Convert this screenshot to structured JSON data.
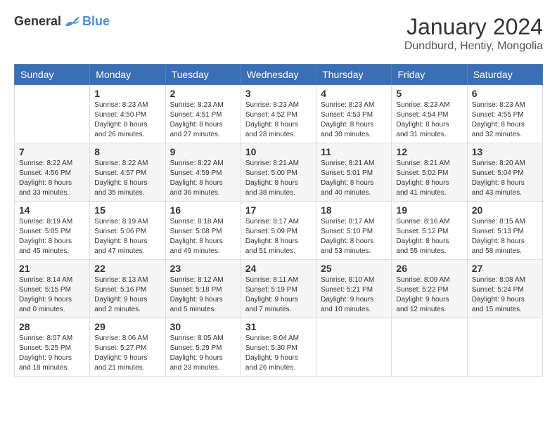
{
  "header": {
    "logo": {
      "general": "General",
      "blue": "Blue"
    },
    "title": "January 2024",
    "location": "Dundburd, Hentiy, Mongolia"
  },
  "weekdays": [
    "Sunday",
    "Monday",
    "Tuesday",
    "Wednesday",
    "Thursday",
    "Friday",
    "Saturday"
  ],
  "weeks": [
    [
      {
        "day": "",
        "sunrise": "",
        "sunset": "",
        "daylight": ""
      },
      {
        "day": "1",
        "sunrise": "Sunrise: 8:23 AM",
        "sunset": "Sunset: 4:50 PM",
        "daylight": "Daylight: 8 hours and 26 minutes."
      },
      {
        "day": "2",
        "sunrise": "Sunrise: 8:23 AM",
        "sunset": "Sunset: 4:51 PM",
        "daylight": "Daylight: 8 hours and 27 minutes."
      },
      {
        "day": "3",
        "sunrise": "Sunrise: 8:23 AM",
        "sunset": "Sunset: 4:52 PM",
        "daylight": "Daylight: 8 hours and 28 minutes."
      },
      {
        "day": "4",
        "sunrise": "Sunrise: 8:23 AM",
        "sunset": "Sunset: 4:53 PM",
        "daylight": "Daylight: 8 hours and 30 minutes."
      },
      {
        "day": "5",
        "sunrise": "Sunrise: 8:23 AM",
        "sunset": "Sunset: 4:54 PM",
        "daylight": "Daylight: 8 hours and 31 minutes."
      },
      {
        "day": "6",
        "sunrise": "Sunrise: 8:23 AM",
        "sunset": "Sunset: 4:55 PM",
        "daylight": "Daylight: 8 hours and 32 minutes."
      }
    ],
    [
      {
        "day": "7",
        "sunrise": "Sunrise: 8:22 AM",
        "sunset": "Sunset: 4:56 PM",
        "daylight": "Daylight: 8 hours and 33 minutes."
      },
      {
        "day": "8",
        "sunrise": "Sunrise: 8:22 AM",
        "sunset": "Sunset: 4:57 PM",
        "daylight": "Daylight: 8 hours and 35 minutes."
      },
      {
        "day": "9",
        "sunrise": "Sunrise: 8:22 AM",
        "sunset": "Sunset: 4:59 PM",
        "daylight": "Daylight: 8 hours and 36 minutes."
      },
      {
        "day": "10",
        "sunrise": "Sunrise: 8:21 AM",
        "sunset": "Sunset: 5:00 PM",
        "daylight": "Daylight: 8 hours and 38 minutes."
      },
      {
        "day": "11",
        "sunrise": "Sunrise: 8:21 AM",
        "sunset": "Sunset: 5:01 PM",
        "daylight": "Daylight: 8 hours and 40 minutes."
      },
      {
        "day": "12",
        "sunrise": "Sunrise: 8:21 AM",
        "sunset": "Sunset: 5:02 PM",
        "daylight": "Daylight: 8 hours and 41 minutes."
      },
      {
        "day": "13",
        "sunrise": "Sunrise: 8:20 AM",
        "sunset": "Sunset: 5:04 PM",
        "daylight": "Daylight: 8 hours and 43 minutes."
      }
    ],
    [
      {
        "day": "14",
        "sunrise": "Sunrise: 8:19 AM",
        "sunset": "Sunset: 5:05 PM",
        "daylight": "Daylight: 8 hours and 45 minutes."
      },
      {
        "day": "15",
        "sunrise": "Sunrise: 8:19 AM",
        "sunset": "Sunset: 5:06 PM",
        "daylight": "Daylight: 8 hours and 47 minutes."
      },
      {
        "day": "16",
        "sunrise": "Sunrise: 8:18 AM",
        "sunset": "Sunset: 5:08 PM",
        "daylight": "Daylight: 8 hours and 49 minutes."
      },
      {
        "day": "17",
        "sunrise": "Sunrise: 8:17 AM",
        "sunset": "Sunset: 5:09 PM",
        "daylight": "Daylight: 8 hours and 51 minutes."
      },
      {
        "day": "18",
        "sunrise": "Sunrise: 8:17 AM",
        "sunset": "Sunset: 5:10 PM",
        "daylight": "Daylight: 8 hours and 53 minutes."
      },
      {
        "day": "19",
        "sunrise": "Sunrise: 8:16 AM",
        "sunset": "Sunset: 5:12 PM",
        "daylight": "Daylight: 8 hours and 55 minutes."
      },
      {
        "day": "20",
        "sunrise": "Sunrise: 8:15 AM",
        "sunset": "Sunset: 5:13 PM",
        "daylight": "Daylight: 8 hours and 58 minutes."
      }
    ],
    [
      {
        "day": "21",
        "sunrise": "Sunrise: 8:14 AM",
        "sunset": "Sunset: 5:15 PM",
        "daylight": "Daylight: 9 hours and 0 minutes."
      },
      {
        "day": "22",
        "sunrise": "Sunrise: 8:13 AM",
        "sunset": "Sunset: 5:16 PM",
        "daylight": "Daylight: 9 hours and 2 minutes."
      },
      {
        "day": "23",
        "sunrise": "Sunrise: 8:12 AM",
        "sunset": "Sunset: 5:18 PM",
        "daylight": "Daylight: 9 hours and 5 minutes."
      },
      {
        "day": "24",
        "sunrise": "Sunrise: 8:11 AM",
        "sunset": "Sunset: 5:19 PM",
        "daylight": "Daylight: 9 hours and 7 minutes."
      },
      {
        "day": "25",
        "sunrise": "Sunrise: 8:10 AM",
        "sunset": "Sunset: 5:21 PM",
        "daylight": "Daylight: 9 hours and 10 minutes."
      },
      {
        "day": "26",
        "sunrise": "Sunrise: 8:09 AM",
        "sunset": "Sunset: 5:22 PM",
        "daylight": "Daylight: 9 hours and 12 minutes."
      },
      {
        "day": "27",
        "sunrise": "Sunrise: 8:08 AM",
        "sunset": "Sunset: 5:24 PM",
        "daylight": "Daylight: 9 hours and 15 minutes."
      }
    ],
    [
      {
        "day": "28",
        "sunrise": "Sunrise: 8:07 AM",
        "sunset": "Sunset: 5:25 PM",
        "daylight": "Daylight: 9 hours and 18 minutes."
      },
      {
        "day": "29",
        "sunrise": "Sunrise: 8:06 AM",
        "sunset": "Sunset: 5:27 PM",
        "daylight": "Daylight: 9 hours and 21 minutes."
      },
      {
        "day": "30",
        "sunrise": "Sunrise: 8:05 AM",
        "sunset": "Sunset: 5:29 PM",
        "daylight": "Daylight: 9 hours and 23 minutes."
      },
      {
        "day": "31",
        "sunrise": "Sunrise: 8:04 AM",
        "sunset": "Sunset: 5:30 PM",
        "daylight": "Daylight: 9 hours and 26 minutes."
      },
      {
        "day": "",
        "sunrise": "",
        "sunset": "",
        "daylight": ""
      },
      {
        "day": "",
        "sunrise": "",
        "sunset": "",
        "daylight": ""
      },
      {
        "day": "",
        "sunrise": "",
        "sunset": "",
        "daylight": ""
      }
    ]
  ]
}
